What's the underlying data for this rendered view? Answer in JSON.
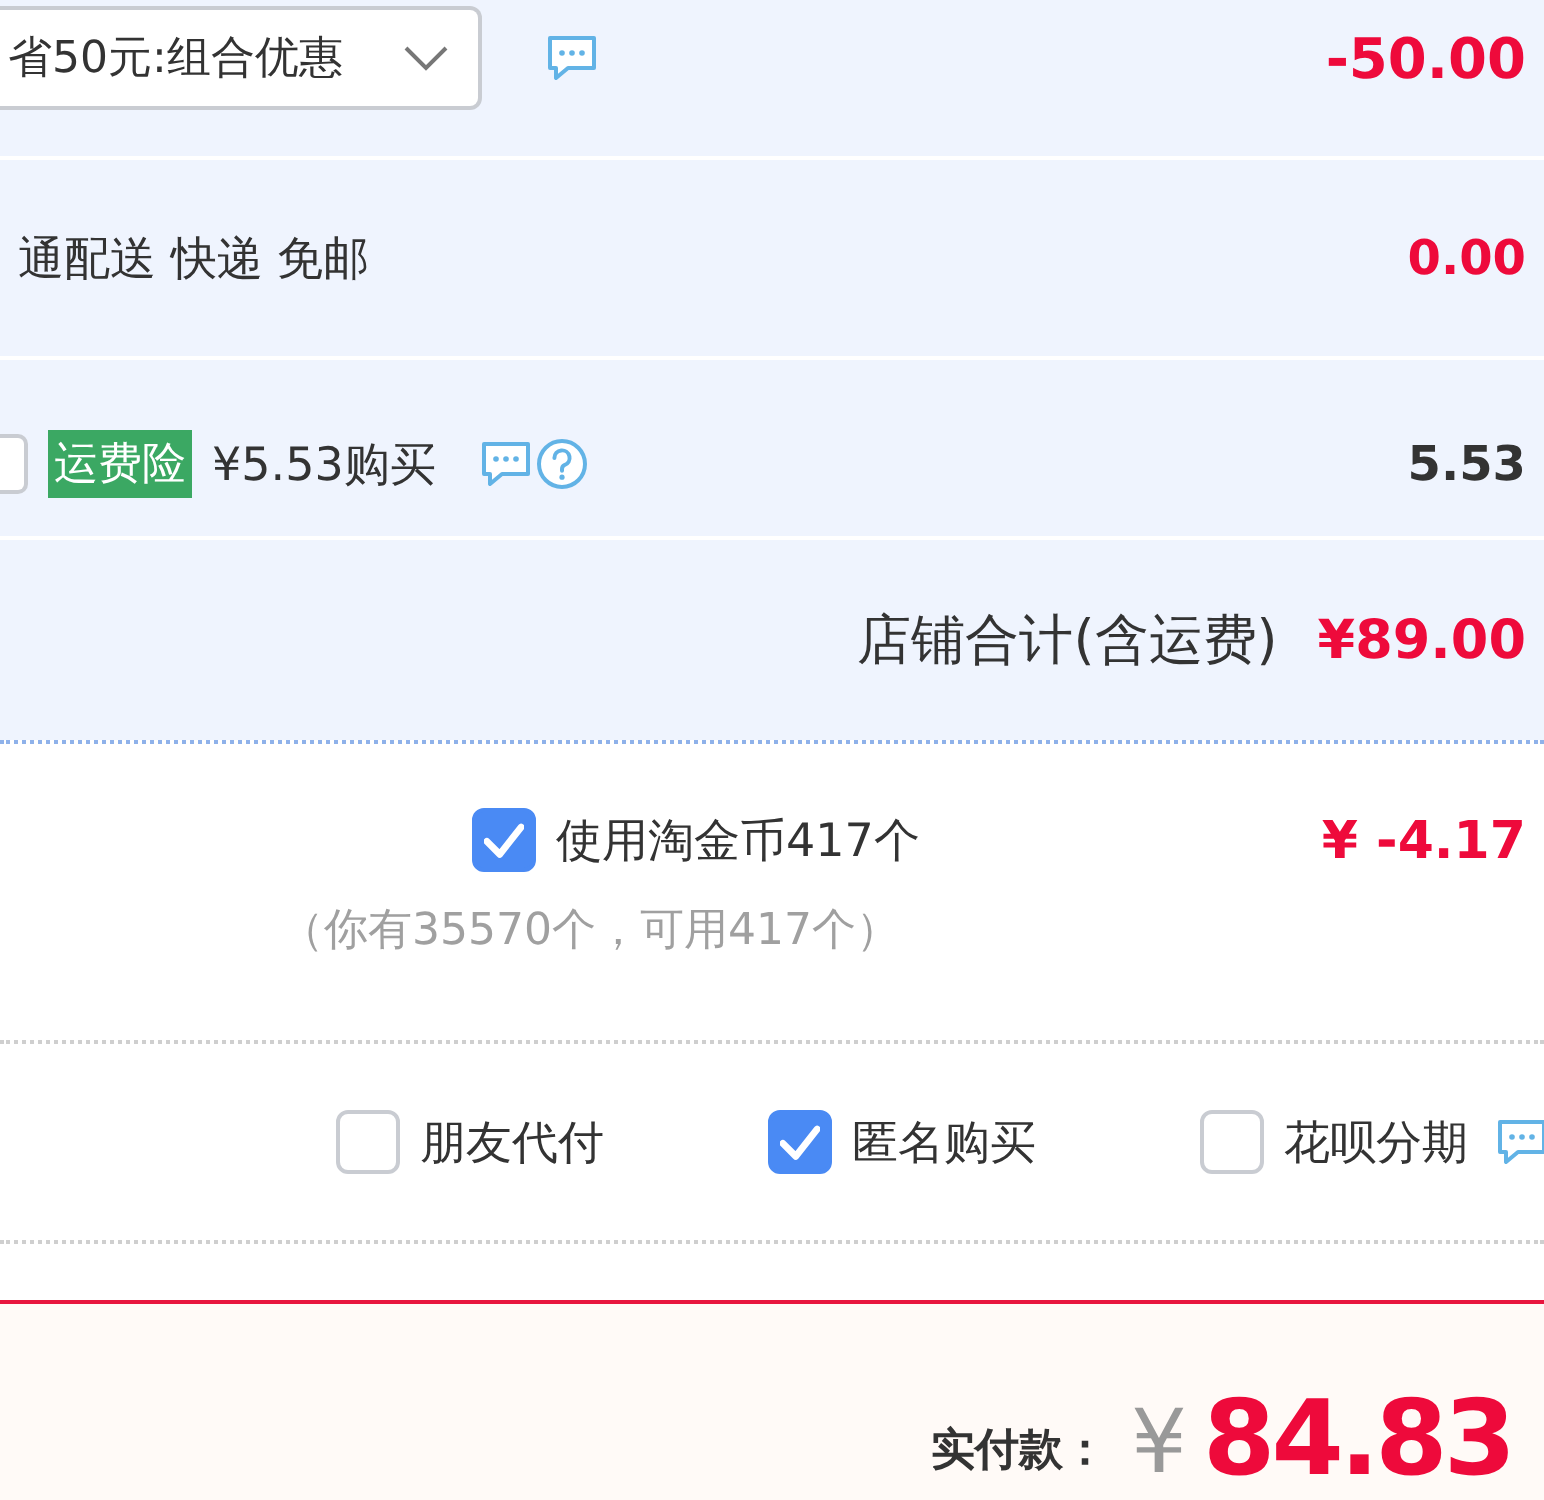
{
  "shop": {
    "promotion": {
      "selected_offer": "省50元:组合优惠",
      "amount": "-50.00"
    },
    "delivery": {
      "method": "通配送 快递 免邮",
      "amount": "0.00"
    },
    "insurance": {
      "checked": false,
      "badge": "运费险",
      "price": "¥5.53购买",
      "amount": "5.53"
    },
    "subtotal": {
      "label": "店铺合计(含运费)",
      "amount": "¥89.00"
    }
  },
  "coins": {
    "checked": true,
    "label": "使用淘金币417个",
    "amount": "¥ -4.17",
    "note": "（你有35570个，可用417个）"
  },
  "options": [
    {
      "label": "朋友代付",
      "checked": false,
      "hint": false
    },
    {
      "label": "匿名购买",
      "checked": true,
      "hint": false
    },
    {
      "label": "花呗分期",
      "checked": false,
      "hint": true
    }
  ],
  "total": {
    "label": "实付款：",
    "currency": "¥",
    "amount": "84.83"
  }
}
